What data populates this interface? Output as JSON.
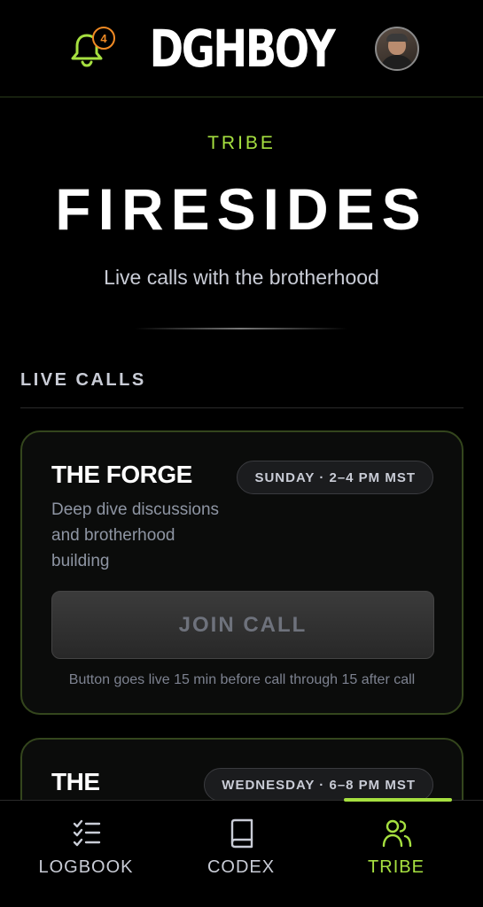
{
  "header": {
    "logo_text": "DGHBOY",
    "notification_count": "4",
    "accent_color": "#a6e040",
    "badge_color": "#f08a24"
  },
  "hero": {
    "eyebrow": "TRIBE",
    "title": "FIRESIDES",
    "subtitle": "Live calls with the brotherhood"
  },
  "section": {
    "label": "LIVE CALLS"
  },
  "calls": [
    {
      "title": "THE FORGE",
      "time": "SUNDAY · 2–4 PM MST",
      "description": "Deep dive discussions and brotherhood building",
      "button_label": "JOIN CALL",
      "note": "Button goes live 15 min before call through 15 after call"
    },
    {
      "title": "THE",
      "time": "WEDNESDAY · 6–8 PM MST"
    }
  ],
  "nav": {
    "items": [
      {
        "label": "LOGBOOK",
        "icon": "checklist-icon",
        "active": false
      },
      {
        "label": "CODEX",
        "icon": "book-icon",
        "active": false
      },
      {
        "label": "TRIBE",
        "icon": "users-icon",
        "active": true
      }
    ]
  }
}
